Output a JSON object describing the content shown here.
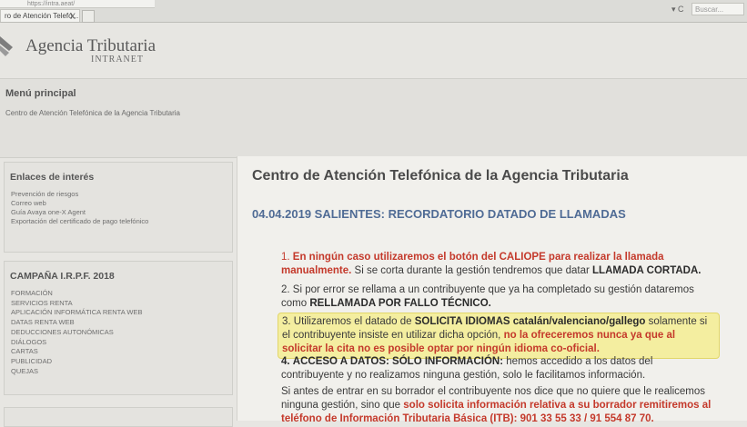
{
  "browser": {
    "url_fragment": "https://intra.aeat/",
    "tab_label": "ro de Atención Telefó...",
    "tab_close": "X",
    "search_placeholder": "Buscar...",
    "nav_glyphs": "▾ C"
  },
  "header": {
    "brand": "Agencia Tributaria",
    "sub": "INTRANET"
  },
  "menu": {
    "title": "Menú principal",
    "link": "Centro de Atención Telefónica de la Agencia Tributaria"
  },
  "links_panel": {
    "title": "Enlaces de interés",
    "items": [
      "Prevención de riesgos",
      "Correo web",
      "Guía Avaya one-X Agent",
      "Exportación del certificado de pago telefónico"
    ]
  },
  "campaign_panel": {
    "title": "CAMPAÑA I.R.P.F. 2018",
    "items": [
      "FORMACIÓN",
      "SERVICIOS RENTA",
      "APLICACIÓN INFORMÁTICA RENTA WEB",
      "DATAS RENTA WEB",
      "DEDUCCIONES AUTONÓMICAS",
      "DIÁLOGOS",
      "CARTAS",
      "PUBLICIDAD",
      "QUEJAS"
    ]
  },
  "content": {
    "title": "Centro de Atención Telefónica de la Agencia Tributaria",
    "subtitle": "04.04.2019 SALIENTES: RECORDATORIO DATADO DE LLAMADAS",
    "p1": {
      "a": "1.",
      "b": "En ningún caso utilizaremos el botón del CALIOPE para realizar la llamada manualmente.",
      "c": "Si se corta durante la gestión tendremos que datar",
      "d": "LLAMADA CORTADA."
    },
    "p2": {
      "a": "2. Si por error se rellama a un contribuyente que ya ha completado su gestión dataremos como",
      "b": "RELLAMADA POR FALLO TÉCNICO."
    },
    "p3": {
      "a": "3. Utilizaremos el datado de",
      "b": "SOLICITA IDIOMAS catalán/valenciano/gallego",
      "c": "solamente si el contribuyente insiste en utilizar dicha opción,",
      "d": "no la ofreceremos nunca ya que al solicitar la cita no es posible optar por ningún idioma co-oficial."
    },
    "p4": {
      "a": "4.",
      "b": "ACCESO A DATOS: SÓLO INFORMACIÓN:",
      "c": "hemos accedido a los datos del contribuyente y no realizamos ninguna gestión, solo le facilitamos información."
    },
    "p5": {
      "a": "Si antes de entrar en su borrador el contribuyente nos dice que no quiere que le realicemos ninguna gestión, sino que",
      "b": "solo solicita información relativa a su borrador remitiremos al teléfono de Información Tributaria Básica (ITB): 901 33 55 33 / 91 554 87 70."
    }
  },
  "colors": {
    "accent_blue": "#4f6b95",
    "alert_red": "#c4392b",
    "highlight": "#f4eea0"
  }
}
